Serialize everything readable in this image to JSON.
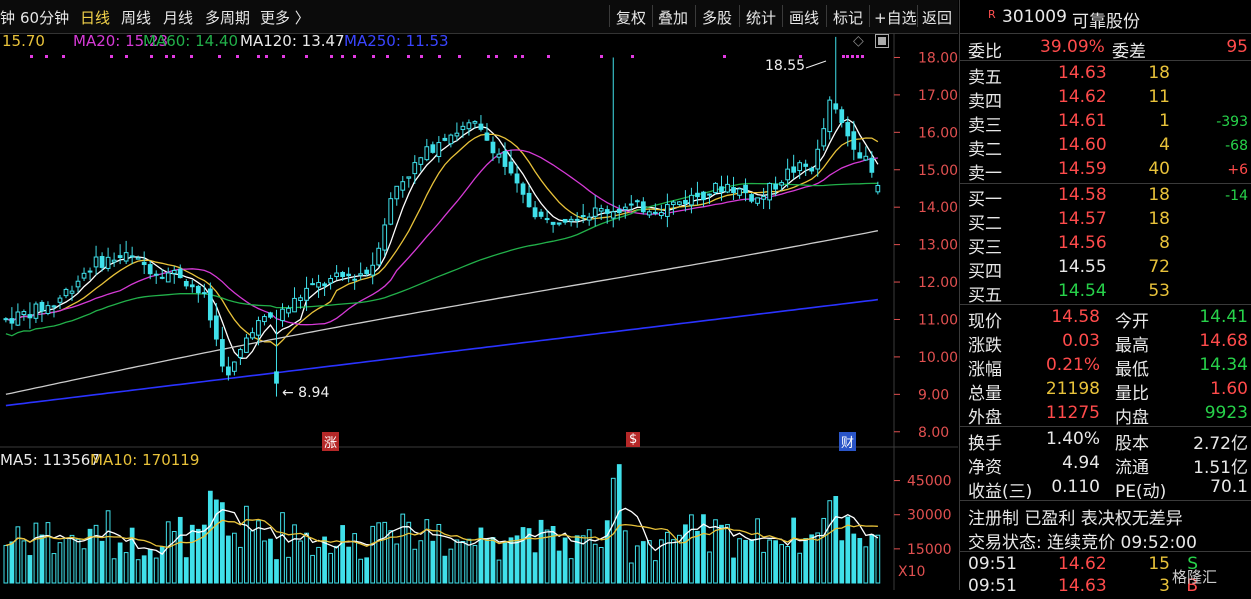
{
  "toolbar": {
    "left_items": [
      "钟",
      "60分钟",
      "日线",
      "周线",
      "月线",
      "多周期",
      "更多 〉"
    ],
    "active": "日线",
    "right_items": [
      "复权",
      "叠加",
      "多股",
      "统计",
      "画线",
      "标记",
      "+自选",
      "返回"
    ]
  },
  "ma_legend": {
    "ma10": "15.70",
    "ma20": "MA20: 15.23",
    "ma60": "MA60: 14.40",
    "ma120": "MA120: 13.47",
    "ma250": "MA250: 11.53"
  },
  "chart_data": {
    "type": "candlestick",
    "price_axis": [
      "18.00",
      "17.00",
      "16.00",
      "15.00",
      "14.00",
      "13.00",
      "12.00",
      "11.00",
      "10.00",
      "9.00",
      "8.00"
    ],
    "ylim": [
      7.7,
      18.6
    ],
    "annotations": {
      "high": "18.55",
      "low": "← 8.94"
    },
    "event_markers": [
      "涨",
      "$",
      "财"
    ],
    "volume_legend": {
      "ma5": "MA5: 113567",
      "ma10": "MA10: 170119"
    },
    "volume_axis": [
      "45000",
      "30000",
      "15000"
    ],
    "volume_unit": "X10",
    "colors": {
      "up": "#40e0ea",
      "down": "#40e0ea",
      "ma5": "#ffffff",
      "ma10": "#e8c23a",
      "ma20": "#d63ad6",
      "ma60": "#22b04a",
      "ma120": "#cccccc",
      "ma250": "#2a33ff"
    }
  },
  "quote": {
    "code": "301009",
    "name": "可靠股份",
    "badge": "R",
    "weibi_label": "委比",
    "weibi": "39.09%",
    "weicha_label": "委差",
    "weicha": "95",
    "sells": [
      {
        "label": "卖五",
        "price": "14.63",
        "vol": "18",
        "chg": ""
      },
      {
        "label": "卖四",
        "price": "14.62",
        "vol": "11",
        "chg": ""
      },
      {
        "label": "卖三",
        "price": "14.61",
        "vol": "1",
        "chg": "-393"
      },
      {
        "label": "卖二",
        "price": "14.60",
        "vol": "4",
        "chg": "-68"
      },
      {
        "label": "卖一",
        "price": "14.59",
        "vol": "40",
        "chg": "+6"
      }
    ],
    "buys": [
      {
        "label": "买一",
        "price": "14.58",
        "vol": "18",
        "chg": "-14"
      },
      {
        "label": "买二",
        "price": "14.57",
        "vol": "18",
        "chg": ""
      },
      {
        "label": "买三",
        "price": "14.56",
        "vol": "8",
        "chg": ""
      },
      {
        "label": "买四",
        "price": "14.55",
        "vol": "72",
        "chg": ""
      },
      {
        "label": "买五",
        "price": "14.54",
        "vol": "53",
        "chg": ""
      }
    ],
    "stats": [
      [
        "现价",
        "14.58",
        "今开",
        "14.41"
      ],
      [
        "涨跌",
        "0.03",
        "最高",
        "14.68"
      ],
      [
        "涨幅",
        "0.21%",
        "最低",
        "14.34"
      ],
      [
        "总量",
        "21198",
        "量比",
        "1.60"
      ],
      [
        "外盘",
        "11275",
        "内盘",
        "9923"
      ]
    ],
    "stats2": [
      [
        "换手",
        "1.40%",
        "股本",
        "2.72亿"
      ],
      [
        "净资",
        "4.94",
        "流通",
        "1.51亿"
      ],
      [
        "收益(三)",
        "0.110",
        "PE(动)",
        "70.1"
      ]
    ],
    "tags": "注册制 已盈利 表决权无差异",
    "trade_status": "交易状态: 连续竞价 09:52:00",
    "ticks": [
      {
        "time": "09:51",
        "price": "14.62",
        "vol": "15",
        "flag": "S"
      },
      {
        "time": "09:51",
        "price": "14.63",
        "vol": "3",
        "flag": "B"
      }
    ],
    "watermark": "格隆汇"
  }
}
